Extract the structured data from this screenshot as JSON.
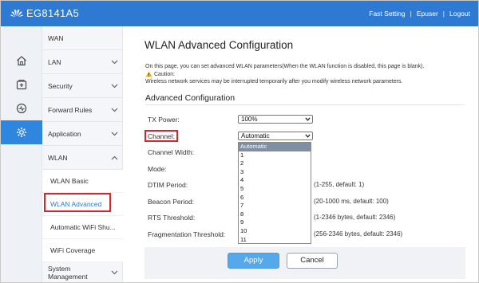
{
  "header": {
    "brand": "EG8141A5",
    "links": [
      "Fast Setting",
      "Epuser",
      "Logout"
    ],
    "separator": "|",
    "bar_color": "#2e7ad3"
  },
  "rail": {
    "icons": [
      "home-icon",
      "security-icon",
      "forward-rules-icon",
      "application-icon"
    ],
    "active_index": 3,
    "active_color": "#2e86de"
  },
  "menu": {
    "items": [
      "WAN",
      "LAN",
      "Security",
      "Forward Rules",
      "Application",
      "WLAN"
    ],
    "wlan_sub": [
      "WLAN Basic",
      "WLAN Advanced",
      "Automatic WiFi Shu...",
      "WiFi Coverage"
    ],
    "system": "System Management",
    "active_sub": "WLAN Advanced",
    "active_color": "#2e7ad3"
  },
  "main": {
    "title": "WLAN Advanced Configuration",
    "description": "On this page, you can set advanced WLAN parameters(When the WLAN function is disabled, this page is blank).",
    "caution_label": "Caution:",
    "caution_text": "Wireless network services may be interrupted temporarily after you modify wireless network parameters.",
    "section": "Advanced Configuration",
    "fields": {
      "tx_power": {
        "label": "TX Power:",
        "value": "100%"
      },
      "channel": {
        "label": "Channel:",
        "value": "Automatic"
      },
      "channel_width": {
        "label": "Channel Width:"
      },
      "mode": {
        "label": "Mode:"
      },
      "dtim": {
        "label": "DTIM Period:",
        "hint": "(1-255, default: 1)"
      },
      "beacon": {
        "label": "Beacon Period:",
        "hint": "(20-1000 ms, default: 100)"
      },
      "rts": {
        "label": "RTS Threshold:",
        "hint": "(1-2346 bytes, default: 2346)"
      },
      "frag": {
        "label": "Fragmentation Threshold:",
        "hint": "(256-2346 bytes, default: 2346)"
      }
    },
    "channel_options": [
      "Automatic",
      "1",
      "2",
      "3",
      "4",
      "5",
      "6",
      "7",
      "8",
      "9",
      "10",
      "11"
    ],
    "channel_selected": "Automatic",
    "apply_label": "Apply",
    "cancel_label": "Cancel",
    "highlight_color": "#d9232d"
  }
}
